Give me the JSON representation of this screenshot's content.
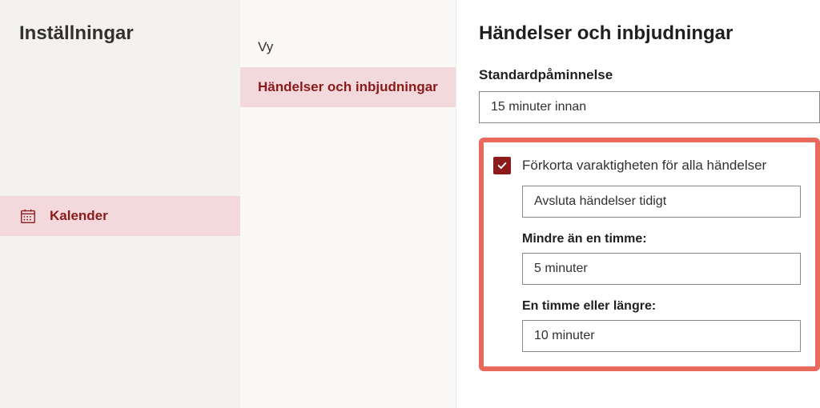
{
  "col1": {
    "title": "Inställningar",
    "items": [
      {
        "label": "Kalender"
      }
    ]
  },
  "col2": {
    "items": [
      {
        "label": "Vy"
      },
      {
        "label": "Händelser och inbjudningar"
      }
    ]
  },
  "col3": {
    "title": "Händelser och inbjudningar",
    "default_reminder_label": "Standardpåminnelse",
    "default_reminder_value": "15 minuter innan",
    "shorten_checkbox_label": "Förkorta varaktigheten för alla händelser",
    "shorten_mode_value": "Avsluta händelser tidigt",
    "less_than_hour_label": "Mindre än en timme:",
    "less_than_hour_value": "5 minuter",
    "hour_or_more_label": "En timme eller längre:",
    "hour_or_more_value": "10 minuter"
  }
}
